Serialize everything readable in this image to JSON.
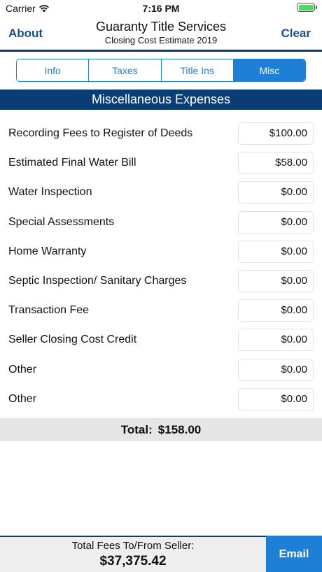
{
  "status_bar": {
    "carrier": "Carrier",
    "time": "7:16 PM",
    "wifi_icon": "wifi-icon",
    "battery_icon": "battery-icon",
    "battery_level": 1.0
  },
  "nav": {
    "left_label": "About",
    "title": "Guaranty Title Services",
    "subtitle": "Closing Cost Estimate 2019",
    "right_label": "Clear"
  },
  "tabs": [
    {
      "label": "Info",
      "active": false
    },
    {
      "label": "Taxes",
      "active": false
    },
    {
      "label": "Title Ins",
      "active": false
    },
    {
      "label": "Misc",
      "active": true
    }
  ],
  "section_title": "Miscellaneous Expenses",
  "rows": [
    {
      "label": "Recording Fees to Register of Deeds",
      "value": "$100.00"
    },
    {
      "label": "Estimated Final Water Bill",
      "value": "$58.00"
    },
    {
      "label": "Water Inspection",
      "value": "$0.00"
    },
    {
      "label": "Special Assessments",
      "value": "$0.00"
    },
    {
      "label": "Home Warranty",
      "value": "$0.00"
    },
    {
      "label": "Septic Inspection/ Sanitary Charges",
      "value": "$0.00"
    },
    {
      "label": "Transaction Fee",
      "value": "$0.00"
    },
    {
      "label": "Seller Closing Cost Credit",
      "value": "$0.00"
    },
    {
      "label": "Other",
      "value": "$0.00"
    },
    {
      "label": "Other",
      "value": "$0.00"
    }
  ],
  "total": {
    "label": "Total:",
    "value": "$158.00"
  },
  "footer": {
    "label": "Total Fees To/From Seller:",
    "amount": "$37,375.42",
    "email_label": "Email"
  },
  "colors": {
    "brand_navy": "#0b3d75",
    "accent_blue": "#1e7fd6",
    "battery_green": "#4cd964"
  }
}
